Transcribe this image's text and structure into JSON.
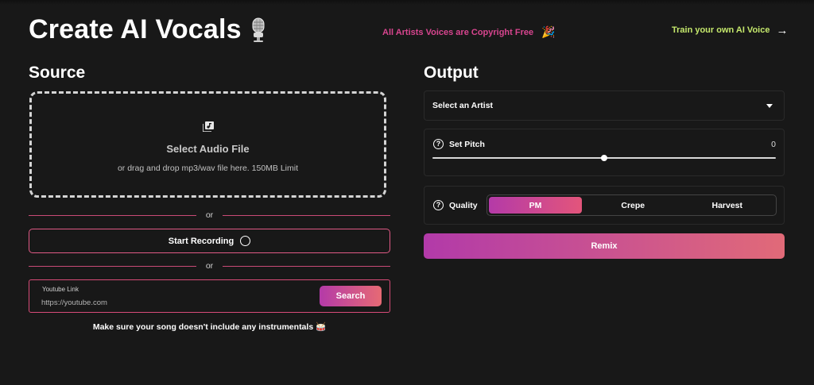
{
  "header": {
    "title": "Create AI Vocals",
    "promo_text": "All Artists Voices are Copyright Free",
    "train_link": "Train your own AI Voice"
  },
  "source": {
    "heading": "Source",
    "dropzone": {
      "title": "Select Audio File",
      "subtitle": "or drag and drop mp3/wav file here. 150MB Limit"
    },
    "divider_text": "or",
    "record_label": "Start Recording",
    "youtube": {
      "label": "Youtube Link",
      "placeholder": "https://youtube.com",
      "value": "",
      "search_label": "Search"
    },
    "warning": "Make sure your song doesn't include any instrumentals"
  },
  "output": {
    "heading": "Output",
    "artist_select": {
      "selected": "Select an Artist"
    },
    "pitch": {
      "label": "Set Pitch",
      "value": "0",
      "slider_fraction": 0.5
    },
    "quality": {
      "label": "Quality",
      "options": [
        "PM",
        "Crepe",
        "Harvest"
      ],
      "selected": "PM"
    },
    "remix_label": "Remix"
  },
  "colors": {
    "background": "#181818",
    "accent_pink": "#d8458f",
    "accent_green": "#c5e86c",
    "gradient_start": "#b43aa8",
    "gradient_end": "#e66a74"
  },
  "icons": {
    "title_icon": "microphone-icon",
    "promo_icon": "party-popper-icon",
    "train_icon": "arrow-right-icon",
    "upload_icon": "music-file-icon",
    "record_icon": "circle-record-icon",
    "help_icon": "question-circle-icon",
    "dropdown_icon": "caret-down-icon",
    "warning_icon": "drum-icon"
  }
}
